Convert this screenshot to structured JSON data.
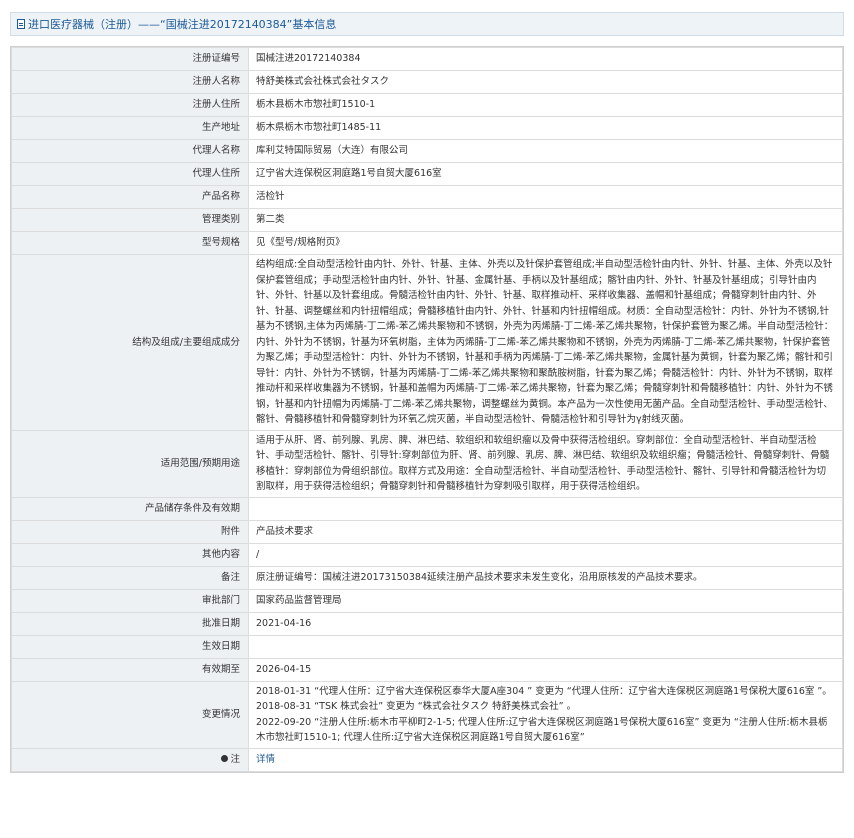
{
  "header": {
    "title": "进口医疗器械（注册）——“国械注进20172140384”基本信息"
  },
  "rows": [
    {
      "label": "注册证编号",
      "value": "国械注进20172140384"
    },
    {
      "label": "注册人名称",
      "value": "特舒美株式会社株式会社タスク"
    },
    {
      "label": "注册人住所",
      "value": "栃木县栃木市惣社町1510-1"
    },
    {
      "label": "生产地址",
      "value": "栃木県栃木市惣社町1485-11"
    },
    {
      "label": "代理人名称",
      "value": "库利艾特国际贸易（大连）有限公司"
    },
    {
      "label": "代理人住所",
      "value": "辽宁省大连保税区洞庭路1号自贸大厦616室"
    },
    {
      "label": "产品名称",
      "value": "活检针"
    },
    {
      "label": "管理类别",
      "value": "第二类"
    },
    {
      "label": "型号规格",
      "value": "见《型号/规格附页》"
    },
    {
      "label": "结构及组成/主要组成成分",
      "value": "结构组成:全自动型活检针由内针、外针、针基、主体、外壳以及针保护套管组成;半自动型活检针由内针、外针、针基、主体、外壳以及针保护套管组成；手动型活检针由内针、外针、针基、金属针基、手柄以及针基组成；髂针由内针、外针、针基及针基组成；引导针由内针、外针、针基以及针套组成。骨髓活检针由内针、外针、针基、取样推动杆、采样收集器、盖帽和针基组成；骨髓穿刺针由内针、外针、针基、调整螺丝和内针扭帽组成；骨髓移植针由内针、外针、针基和内针扭帽组成。材质：全自动型活检针：内针、外针为不锈钢,针基为不锈钢,主体为丙烯腈-丁二烯-苯乙烯共聚物和不锈钢，外壳为丙烯腈-丁二烯-苯乙烯共聚物，针保护套管为聚乙烯。半自动型活检针：内针、外针为不锈钢，针基为环氧树脂，主体为丙烯腈-丁二烯-苯乙烯共聚物和不锈钢，外壳为丙烯腈-丁二烯-苯乙烯共聚物，针保护套管为聚乙烯；手动型活检针：内针、外针为不锈钢，针基和手柄为丙烯腈-丁二烯-苯乙烯共聚物，金属针基为黄铜，针套为聚乙烯；髂针和引导针：内针、外针为不锈钢，针基为丙烯腈-丁二烯-苯乙烯共聚物和聚酰胺树脂，针套为聚乙烯；骨髓活检针：内针、外针为不锈钢，取样推动杆和采样收集器为不锈钢，针基和盖帽为丙烯腈-丁二烯-苯乙烯共聚物，针套为聚乙烯；骨髓穿刺针和骨髓移植针：内针、外针为不锈钢，针基和内针扭帽为丙烯腈-丁二烯-苯乙烯共聚物，调整螺丝为黄铜。本产品为一次性使用无菌产品。全自动型活检针、手动型活检针、髂针、骨髓移植针和骨髓穿刺针为环氧乙烷灭菌，半自动型活检针、骨髓活检针和引导针为γ射线灭菌。"
    },
    {
      "label": "适用范围/预期用途",
      "value": "适用于从肝、肾、前列腺、乳房、脾、淋巴结、软组织和软组织瘤以及骨中获得活检组织。穿刺部位：全自动型活检针、半自动型活检针、手动型活检针、髂针、引导针:穿刺部位为肝、肾、前列腺、乳房、脾、淋巴结、软组织及软组织瘤；骨髓活检针、骨髓穿刺针、骨髓移植针：穿刺部位为骨组织部位。取样方式及用途：全自动型活检针、半自动型活检针、手动型活检针、髂针、引导针和骨髓活检针为切割取样，用于获得活检组织；骨髓穿刺针和骨髓移植针为穿刺吸引取样，用于获得活检组织。"
    },
    {
      "label": "产品储存条件及有效期",
      "value": ""
    },
    {
      "label": "附件",
      "value": "产品技术要求"
    },
    {
      "label": "其他内容",
      "value": "/"
    },
    {
      "label": "备注",
      "value": "原注册证编号：国械注进20173150384延续注册产品技术要求未发生变化，沿用原核发的产品技术要求。"
    },
    {
      "label": "审批部门",
      "value": "国家药品监督管理局"
    },
    {
      "label": "批准日期",
      "value": "2021-04-16"
    },
    {
      "label": "生效日期",
      "value": ""
    },
    {
      "label": "有效期至",
      "value": "2026-04-15"
    }
  ],
  "changes": {
    "label": "变更情况",
    "lines": [
      "2018-01-31 “代理人住所：辽宁省大连保税区泰华大厦A座304 ” 变更为 “代理人住所：辽宁省大连保税区洞庭路1号保税大厦616室 ”。",
      "2018-08-31 “TSK 株式会社” 变更为 “株式会社タスク 特舒美株式会社” 。",
      "2022-09-20 “注册人住所:栃木市平柳町2-1-5; 代理人住所:辽宁省大连保税区洞庭路1号保税大厦616室” 变更为 “注册人住所:栃木县栃木市惣社町1510-1; 代理人住所:辽宁省大连保税区洞庭路1号自贸大厦616室”"
    ]
  },
  "note": {
    "label": "注",
    "link_text": "详情"
  }
}
